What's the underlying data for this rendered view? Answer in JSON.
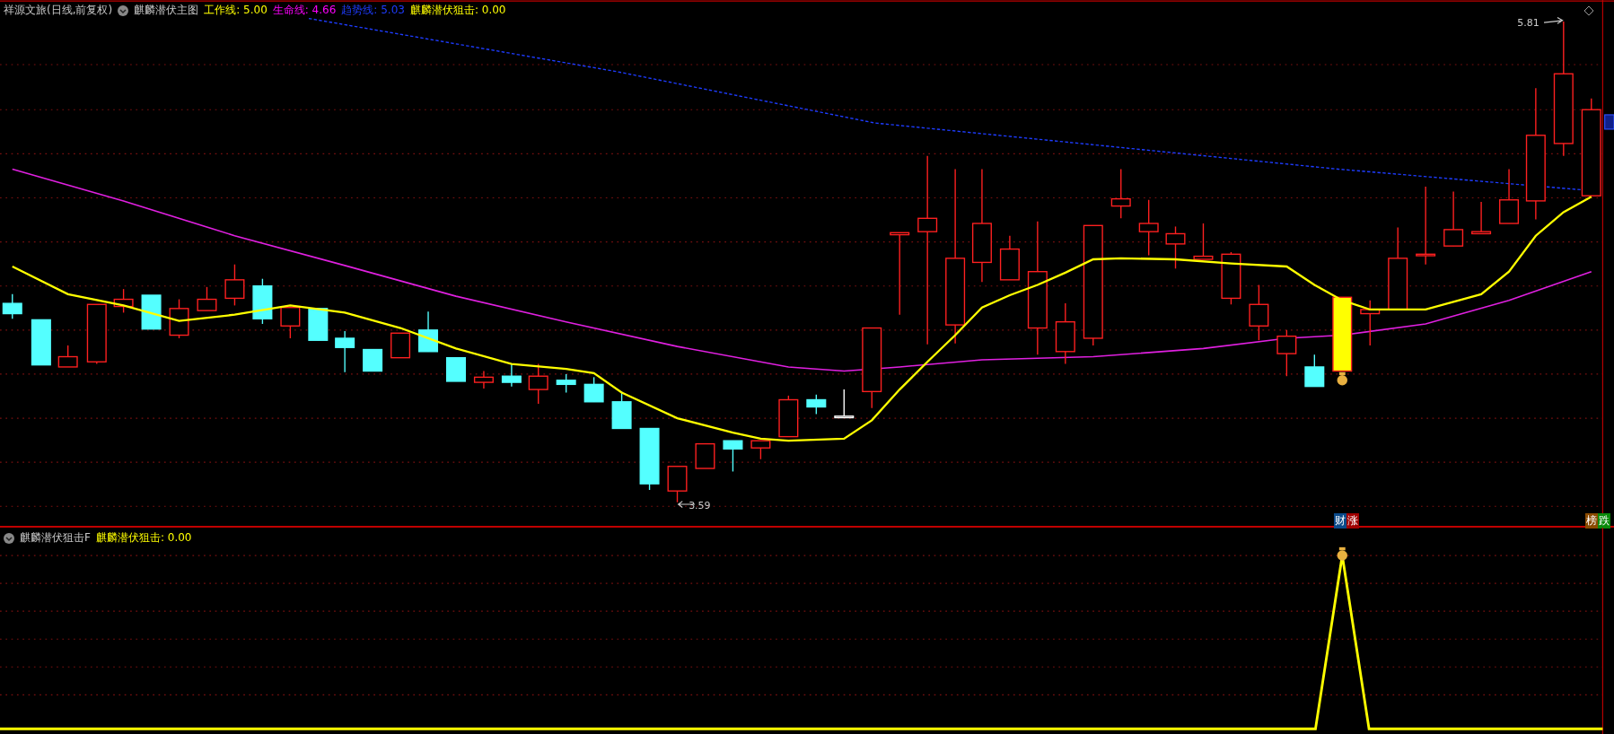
{
  "main_chart": {
    "stock": "祥源文旅(日线,前复权)",
    "indicator": "麒麟潜伏主图",
    "legend": [
      {
        "label": "工作线: 5.00",
        "color": "#ffff00"
      },
      {
        "label": "生命线: 4.66",
        "color": "#ff00ff"
      },
      {
        "label": "趋势线: 5.03",
        "color": "#1e3cff"
      },
      {
        "label": "麒麟潜伏狙击: 0.00",
        "color": "#ffff00"
      }
    ],
    "high_label": "5.81",
    "low_label": "3.59",
    "signals": [
      {
        "chars": [
          {
            "text": "财",
            "color": "#0b4a8a"
          },
          {
            "text": "涨",
            "color": "#a00000"
          }
        ]
      },
      {
        "chars": [
          {
            "text": "榜",
            "color": "#8a4a00"
          },
          {
            "text": "跌",
            "color": "#0a8a0a"
          }
        ]
      }
    ]
  },
  "sub_chart": {
    "indicator": "麒麟潜伏狙击F",
    "legend": [
      {
        "label": "麒麟潜伏狙击: 0.00",
        "color": "#ffff00"
      }
    ]
  }
}
